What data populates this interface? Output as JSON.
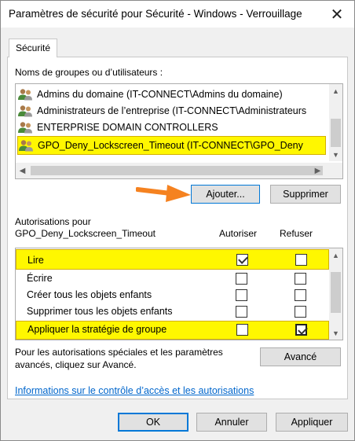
{
  "window": {
    "title": "Paramètres de sécurité pour Sécurité - Windows - Verrouillage",
    "close_glyph": "✕"
  },
  "tab": {
    "label": "Sécurité"
  },
  "groups": {
    "label": "Noms de groupes ou d’utilisateurs :",
    "items": [
      {
        "text": "Admins du domaine (IT-CONNECT\\Admins du domaine)",
        "icon": "users-group-icon",
        "selected": false
      },
      {
        "text": "Administrateurs de l’entreprise (IT-CONNECT\\Administrateurs",
        "icon": "users-group-icon",
        "selected": false
      },
      {
        "text": "ENTERPRISE DOMAIN CONTROLLERS",
        "icon": "users-group-icon",
        "selected": false
      },
      {
        "text": "GPO_Deny_Lockscreen_Timeout (IT-CONNECT\\GPO_Deny",
        "icon": "users-group-icon",
        "selected": true
      }
    ]
  },
  "buttons": {
    "add": "Ajouter...",
    "remove": "Supprimer",
    "advanced": "Avancé",
    "ok": "OK",
    "cancel": "Annuler",
    "apply": "Appliquer"
  },
  "permissions": {
    "label_line1": "Autorisations pour",
    "label_line2": "GPO_Deny_Lockscreen_Timeout",
    "col_allow": "Autoriser",
    "col_deny": "Refuser",
    "rows": [
      {
        "name": "Lire",
        "allow": true,
        "deny": false,
        "highlight": true
      },
      {
        "name": "Écrire",
        "allow": false,
        "deny": false,
        "highlight": false
      },
      {
        "name": "Créer tous les objets enfants",
        "allow": false,
        "deny": false,
        "highlight": false
      },
      {
        "name": "Supprimer tous les objets enfants",
        "allow": false,
        "deny": false,
        "highlight": false
      },
      {
        "name": "Appliquer la stratégie de groupe",
        "allow": false,
        "deny": true,
        "highlight": true
      }
    ]
  },
  "advanced_text": {
    "line1": "Pour les autorisations spéciales et les paramètres",
    "line2": "avancés, cliquez sur Avancé."
  },
  "link": "Informations sur le contrôle d’accès et les autorisations",
  "colors": {
    "highlight": "#fff700",
    "accent": "#0078d7",
    "annotation_arrow": "#f58220"
  }
}
